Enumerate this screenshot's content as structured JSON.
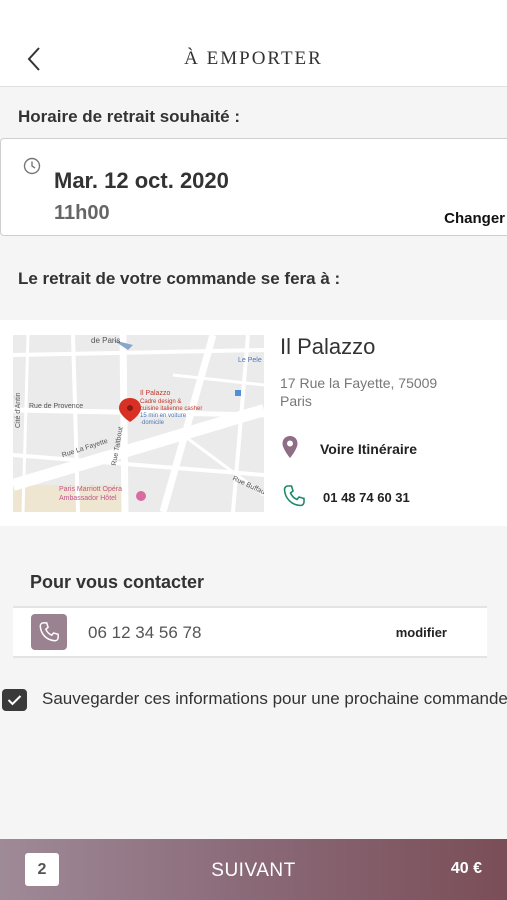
{
  "header": {
    "title": "À EMPORTER",
    "back_icon": "chevron-left-icon"
  },
  "pickup_time": {
    "label": "Horaire de retrait souhaité :",
    "date": "Mar. 12 oct. 2020",
    "time": "11h00",
    "change_label": "Changer",
    "icon": "clock-icon"
  },
  "pickup_place": {
    "label": "Le retrait de votre commande se fera à :",
    "name": "Il Palazzo",
    "address": "17 Rue la Fayette, 75009 Paris",
    "route_label": "Voire Itinéraire",
    "phone": "01 48 74 60 31",
    "map": {
      "labels": [
        "de Paris",
        "Le Pele",
        "Rue de Provence",
        "Cité d'Antin",
        "Rue La Fayette",
        "Rue Taitbout",
        "Rue Buffault"
      ],
      "pin_title": "Il Palazzo",
      "pin_subtitle": [
        "Cadre design &",
        "cuisine italienne casher",
        "15 min en voiture",
        "·domicile"
      ],
      "poi": [
        "Paris Marriott Opéra",
        "Ambassador Hôtel"
      ]
    },
    "colors": {
      "pin": "#8e6e84",
      "phone": "#1f8a6a"
    }
  },
  "contact": {
    "label": "Pour vous contacter",
    "phone": "06 12 34 56 78",
    "modify_label": "modifier",
    "icon": "phone-icon"
  },
  "save_info": {
    "checked": true,
    "label": "Sauvegarder ces informations pour une prochaine commande"
  },
  "footer": {
    "quantity": "2",
    "next_label": "SUIVANT",
    "total": "40 €",
    "colors": {
      "start": "#9f8a98",
      "end": "#7a4e57"
    }
  }
}
